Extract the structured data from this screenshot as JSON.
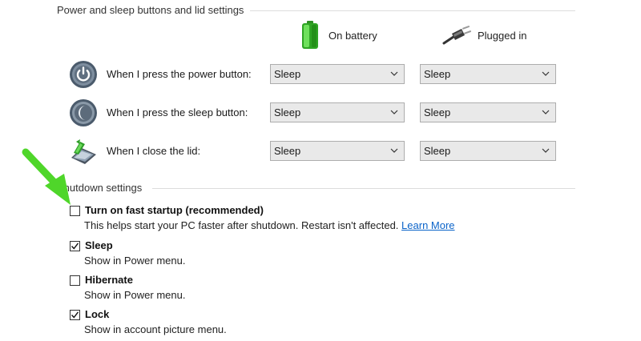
{
  "power_section": {
    "header": "Power and sleep buttons and lid settings",
    "columns": {
      "on_battery": "On battery",
      "plugged_in": "Plugged in"
    },
    "rows": [
      {
        "label": "When I press the power button:",
        "on_battery": "Sleep",
        "plugged_in": "Sleep"
      },
      {
        "label": "When I press the sleep button:",
        "on_battery": "Sleep",
        "plugged_in": "Sleep"
      },
      {
        "label": "When I close the lid:",
        "on_battery": "Sleep",
        "plugged_in": "Sleep"
      }
    ]
  },
  "shutdown_section": {
    "header": "Shutdown settings",
    "items": [
      {
        "title": "Turn on fast startup (recommended)",
        "description": "This helps start your PC faster after shutdown. Restart isn't affected.",
        "link": "Learn More",
        "checked": false
      },
      {
        "title": "Sleep",
        "description": "Show in Power menu.",
        "checked": true
      },
      {
        "title": "Hibernate",
        "description": "Show in Power menu.",
        "checked": false
      },
      {
        "title": "Lock",
        "description": "Show in account picture menu.",
        "checked": true
      }
    ]
  },
  "colors": {
    "link": "#0a63c9",
    "annotation_arrow": "#4fd62a",
    "battery_green": "#38b82c"
  },
  "icons": {
    "battery": "battery-icon",
    "plug": "plug-icon",
    "power_button": "power-button-icon",
    "sleep_button": "sleep-button-icon",
    "lid": "laptop-lid-icon",
    "dropdown": "chevron-down-icon",
    "checkmark": "checkmark-icon",
    "annotation": "green-arrow-icon"
  }
}
